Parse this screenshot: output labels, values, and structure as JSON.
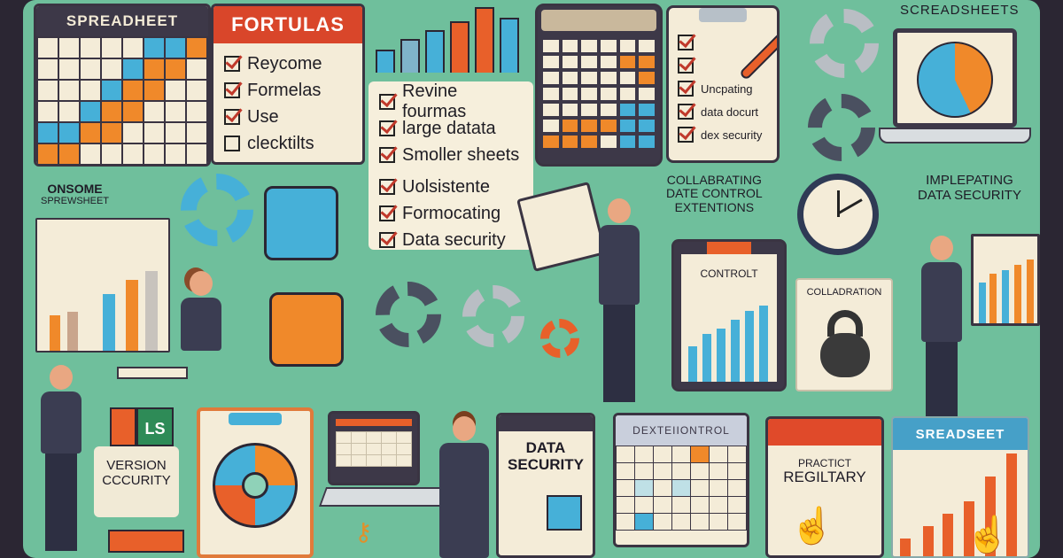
{
  "panels": {
    "spreadsheet_top_left": {
      "title": "SPREADHEET"
    },
    "formulas_card": {
      "title": "FORTULAS",
      "items": [
        {
          "label": "Reycome",
          "checked": true
        },
        {
          "label": "Formelas",
          "checked": true
        },
        {
          "label": "Use",
          "checked": true
        },
        {
          "label": "clecktilts",
          "checked": false
        }
      ]
    },
    "checklist_center": {
      "items": [
        {
          "label": "Revine fourmas",
          "checked": true
        },
        {
          "label": "large datata",
          "checked": true
        },
        {
          "label": "Smoller sheets",
          "checked": true
        },
        {
          "label": "Uolsistente",
          "checked": true
        },
        {
          "label": "Formocating",
          "checked": true
        },
        {
          "label": "Data security",
          "checked": true
        }
      ]
    },
    "clipboard_top": {
      "items": [
        {
          "label": "",
          "checked": true
        },
        {
          "label": "",
          "checked": true
        },
        {
          "label": "Uncpating",
          "checked": true
        },
        {
          "label": "data docurt",
          "checked": true
        },
        {
          "label": "dex security",
          "checked": true
        }
      ]
    },
    "laptop_top_right": {
      "title": "SCREADSHEETS",
      "pie_label": "%"
    },
    "onsome_sheet": {
      "title_line1": "ONSOME",
      "title_line2": "SPREWSHEET"
    },
    "collaborating_text": {
      "line1": "COLLABRATING",
      "line2": "DATE CONTROL",
      "line3": "EXTENTIONS"
    },
    "implementing_text": {
      "line1": "IMPLEPATING",
      "line2": "DATA SECURITY"
    },
    "control_clipboard": {
      "title": "CONTROLT"
    },
    "collaboration_card": {
      "title": "COLLADRATION"
    },
    "version_card": {
      "badge": "LS",
      "line1": "VERSION",
      "line2": "CCCURITY"
    },
    "data_security_calendar": {
      "line1": "DATA",
      "line2": "SECURITY"
    },
    "dexcontrol_calendar": {
      "title": "DEXTEIIONTROL"
    },
    "practice_calendar": {
      "line1": "PRACTICT",
      "line2": "REGILTARY"
    },
    "spreadsheet_bottom_right": {
      "title": "SREADSEET"
    }
  },
  "colors": {
    "background": "#6fbf9c",
    "orange": "#f0892a",
    "blue": "#46b0d8",
    "red": "#e8602a",
    "dark": "#3d3848",
    "paper": "#f4ecd8"
  }
}
